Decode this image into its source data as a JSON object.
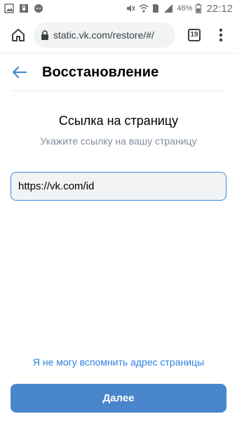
{
  "status_bar": {
    "battery_percent": "46%",
    "time": "22:12",
    "sim_number": "1",
    "icons": [
      "image-icon",
      "lock-notification-icon",
      "chat-icon",
      "mute-icon",
      "wifi-icon",
      "signal-icon",
      "battery-icon"
    ]
  },
  "browser": {
    "url": "static.vk.com/restore/#/",
    "tab_count": "19",
    "icons": [
      "home-icon",
      "lock-icon",
      "more-vert-icon"
    ]
  },
  "page": {
    "title": "Восстановление",
    "section_title": "Ссылка на страницу",
    "section_subtitle": "Укажите ссылку на вашу страницу",
    "link_input_value": "https://vk.com/id",
    "forgot_link": "Я не могу вспомнить адрес страницы",
    "next_button": "Далее"
  },
  "colors": {
    "accent": "#4986cc",
    "link": "#2d81e0",
    "input_border": "#3f8ae0",
    "subtitle": "#818c99"
  }
}
